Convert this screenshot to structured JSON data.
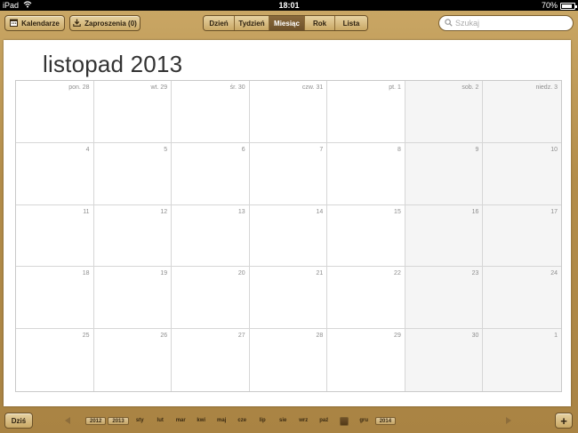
{
  "status": {
    "device": "iPad",
    "time": "18:01",
    "battery": "70%",
    "battery_level": 0.7
  },
  "toolbar": {
    "calendars_label": "Kalendarze",
    "invitations_label": "Zaproszenia (0)",
    "views": [
      "Dzień",
      "Tydzień",
      "Miesiąc",
      "Rok",
      "Lista"
    ],
    "active_view": "Miesiąc",
    "search_placeholder": "Szukaj"
  },
  "month_title": "listopad 2013",
  "calendar": {
    "cells": [
      {
        "label": "pon. 28",
        "weekend": false
      },
      {
        "label": "wt. 29",
        "weekend": false
      },
      {
        "label": "śr. 30",
        "weekend": false
      },
      {
        "label": "czw. 31",
        "weekend": false
      },
      {
        "label": "pt. 1",
        "weekend": false
      },
      {
        "label": "sob. 2",
        "weekend": true
      },
      {
        "label": "niedz. 3",
        "weekend": true
      },
      {
        "label": "4",
        "weekend": false
      },
      {
        "label": "5",
        "weekend": false
      },
      {
        "label": "6",
        "weekend": false
      },
      {
        "label": "7",
        "weekend": false
      },
      {
        "label": "8",
        "weekend": false
      },
      {
        "label": "9",
        "weekend": true
      },
      {
        "label": "10",
        "weekend": true
      },
      {
        "label": "11",
        "weekend": false
      },
      {
        "label": "12",
        "weekend": false
      },
      {
        "label": "13",
        "weekend": false
      },
      {
        "label": "14",
        "weekend": false
      },
      {
        "label": "15",
        "weekend": false
      },
      {
        "label": "16",
        "weekend": true
      },
      {
        "label": "17",
        "weekend": true
      },
      {
        "label": "18",
        "weekend": false
      },
      {
        "label": "19",
        "weekend": false
      },
      {
        "label": "20",
        "weekend": false
      },
      {
        "label": "21",
        "weekend": false
      },
      {
        "label": "22",
        "weekend": false
      },
      {
        "label": "23",
        "weekend": true
      },
      {
        "label": "24",
        "weekend": true
      },
      {
        "label": "25",
        "weekend": false
      },
      {
        "label": "26",
        "weekend": false
      },
      {
        "label": "27",
        "weekend": false
      },
      {
        "label": "28",
        "weekend": false
      },
      {
        "label": "29",
        "weekend": false
      },
      {
        "label": "30",
        "weekend": true
      },
      {
        "label": "1",
        "weekend": true
      }
    ]
  },
  "bottom": {
    "today_label": "Dziś",
    "timeline": [
      {
        "label": "2012",
        "kind": "yr"
      },
      {
        "label": "2013",
        "kind": "yr"
      },
      {
        "label": "sty",
        "kind": "mo"
      },
      {
        "label": "lut",
        "kind": "mo"
      },
      {
        "label": "mar",
        "kind": "mo"
      },
      {
        "label": "kwi",
        "kind": "mo"
      },
      {
        "label": "maj",
        "kind": "mo"
      },
      {
        "label": "cze",
        "kind": "mo"
      },
      {
        "label": "lip",
        "kind": "mo"
      },
      {
        "label": "sie",
        "kind": "mo"
      },
      {
        "label": "wrz",
        "kind": "mo"
      },
      {
        "label": "paź",
        "kind": "mo"
      },
      {
        "label": "",
        "kind": "cur"
      },
      {
        "label": "gru",
        "kind": "mo"
      },
      {
        "label": "2014",
        "kind": "yr"
      }
    ],
    "add_label": "+"
  },
  "colors": {
    "leather": "#b38d4a",
    "active_segment": "#6d512a"
  }
}
